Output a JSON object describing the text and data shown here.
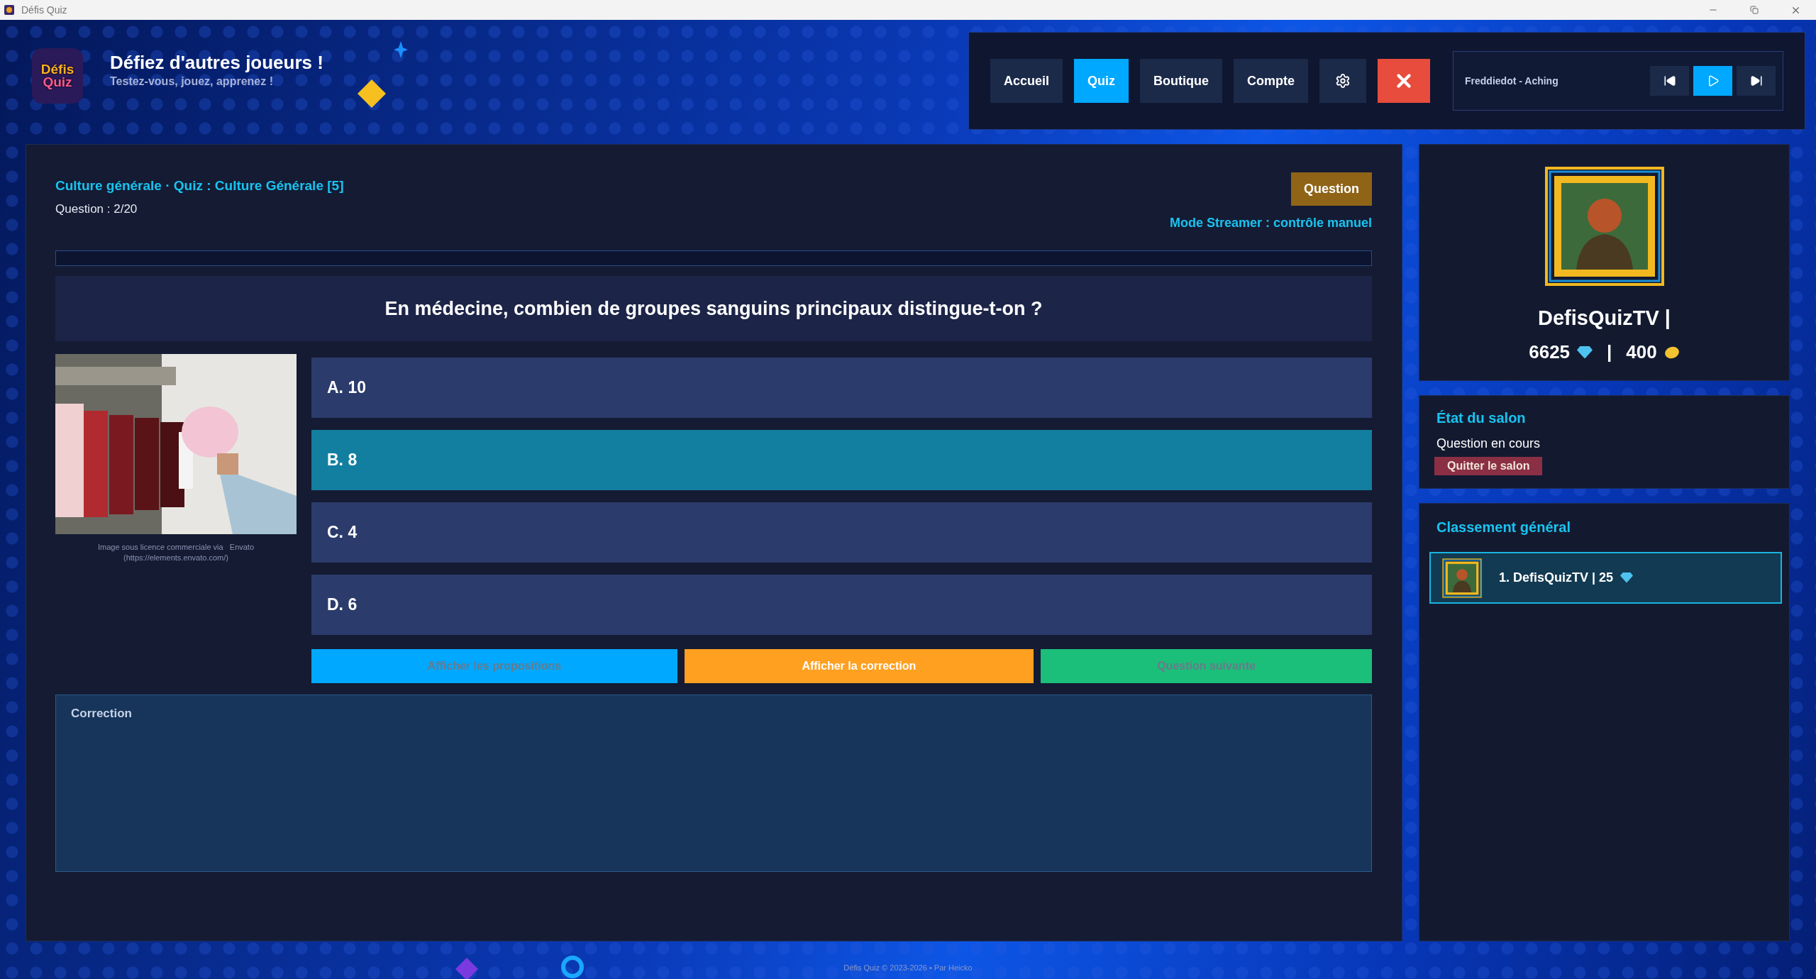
{
  "window": {
    "title": "Défis Quiz"
  },
  "header": {
    "logo": [
      "Défis",
      "Quiz"
    ],
    "title": "Défiez d'autres joueurs !",
    "subtitle": "Testez-vous, jouez, apprenez !"
  },
  "nav": {
    "items": [
      {
        "kind": "text",
        "label": "Accueil",
        "selected": false
      },
      {
        "kind": "text",
        "label": "Quiz",
        "selected": true
      },
      {
        "kind": "text",
        "label": "Boutique",
        "selected": false
      },
      {
        "kind": "text",
        "label": "Compte",
        "selected": false
      },
      {
        "kind": "settings",
        "selected": false
      },
      {
        "kind": "close",
        "selected": false
      }
    ]
  },
  "music": {
    "track": "Freddiedot - Aching",
    "controls": [
      {
        "kind": "previous",
        "selected": false
      },
      {
        "kind": "play",
        "selected": true
      },
      {
        "kind": "next",
        "selected": false
      }
    ]
  },
  "quiz": {
    "breadcrumb": "Culture générale · Quiz : Culture Générale [5]",
    "question_count": "Question : 2/20",
    "phase_badge": "Question",
    "mode": "Mode Streamer : contrôle manuel",
    "progress": {
      "level": 0
    },
    "question": "En médecine, combien de groupes sanguins principaux distingue-t-on ?",
    "image": {
      "kind": "picture",
      "caption": [
        "Image sous licence commerciale via   Envato",
        "(https://elements.envato.com/)"
      ]
    },
    "answers": [
      {
        "label": "A. 10",
        "selected": false
      },
      {
        "label": "B. 8",
        "selected": true
      },
      {
        "label": "C. 4",
        "selected": false
      },
      {
        "label": "D. 6",
        "selected": false
      }
    ],
    "actions": [
      {
        "label": "Afficher les propositions",
        "color": "#00a8ff",
        "disabled": true
      },
      {
        "label": "Afficher la correction",
        "color": "#ffa020",
        "disabled": false
      },
      {
        "label": "Question suivante",
        "color": "#1bbf7a",
        "disabled": true
      }
    ],
    "correction": {
      "label": "Correction"
    }
  },
  "profile": {
    "name": "DefisQuizTV |",
    "gems": "6625",
    "separator": "|",
    "coins": "400"
  },
  "room": {
    "title": "État du salon",
    "status": "Question en cours",
    "leave": "Quitter le salon"
  },
  "ranking": {
    "title": "Classement général",
    "rows": [
      {
        "label": "1. DefisQuizTV | 25"
      }
    ]
  },
  "footer": "Défis Quiz © 2023-2026 • Par Heicko"
}
